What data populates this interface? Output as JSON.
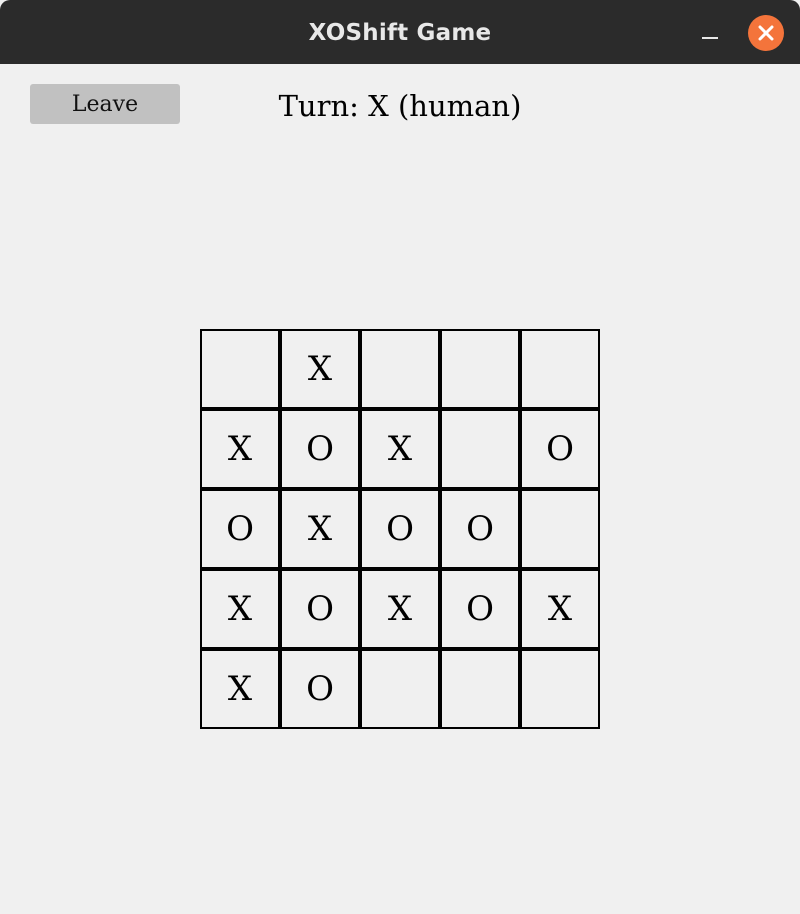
{
  "window": {
    "title": "XOShift Game",
    "close_color": "#f4743b"
  },
  "toolbar": {
    "leave_label": "Leave",
    "turn_text": "Turn: X (human)"
  },
  "board": {
    "rows": [
      [
        "",
        "X",
        "",
        "",
        ""
      ],
      [
        "X",
        "O",
        "X",
        "",
        "O"
      ],
      [
        "O",
        "X",
        "O",
        "O",
        ""
      ],
      [
        "X",
        "O",
        "X",
        "O",
        "X"
      ],
      [
        "X",
        "O",
        "",
        "",
        ""
      ]
    ]
  }
}
